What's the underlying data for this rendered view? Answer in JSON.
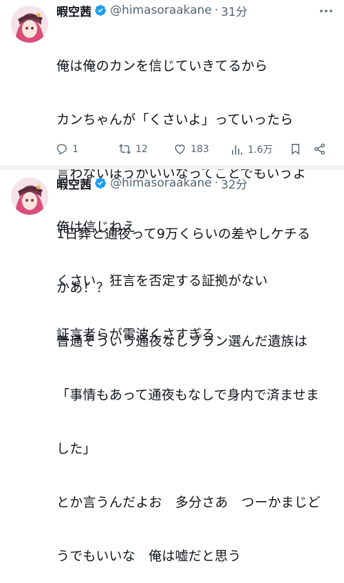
{
  "tweets": [
    {
      "display_name": "暇空茜",
      "handle": "@himasoraakane",
      "separator": "·",
      "time": "31分",
      "lines": [
        "俺は俺のカンを信じていきてるから",
        "カンちゃんが「くさいよ」っていったら",
        "言わないほうがいいなってことでもいうよ",
        "俺は信じねえ",
        "くさい　狂言を否定する証拠がない",
        "証言者らが電波くさすぎる"
      ],
      "stats": {
        "replies": "1",
        "retweets": "12",
        "likes": "183",
        "views": "1.6万"
      }
    },
    {
      "display_name": "暇空茜",
      "handle": "@himasoraakane",
      "separator": "·",
      "time": "32分",
      "lines": [
        "1日葬と通夜って9万くらいの差やしケチる",
        "かあ！？",
        "普通そういう通夜なしプラン選んだ遺族は",
        "「事情もあって通夜もなしで身内で済ませま",
        "した」",
        "とか言うんだよお　多分さあ　つーかまじど",
        "うでもいいな　俺は嘘だと思う"
      ]
    }
  ],
  "colors": {
    "text": "#0f1419",
    "secondary": "#536471",
    "verified": "#1d9bf0",
    "divider": "#eff3f4"
  },
  "icons": [
    "more-icon",
    "verified-icon",
    "reply-icon",
    "retweet-icon",
    "like-icon",
    "views-icon",
    "bookmark-icon",
    "share-icon"
  ]
}
